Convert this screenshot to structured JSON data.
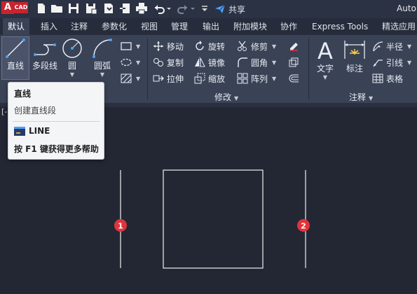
{
  "app": {
    "logo_letter": "A",
    "logo_text": "CAD",
    "share_label": "共享",
    "title": "Auto"
  },
  "quick_access": [
    "new-icon",
    "open-icon",
    "save-icon",
    "save-as-icon",
    "open-from-web-icon",
    "save-to-web-icon",
    "print-icon",
    "undo-icon",
    "redo-icon",
    "customize-icon"
  ],
  "tabs": [
    "默认",
    "插入",
    "注释",
    "参数化",
    "视图",
    "管理",
    "输出",
    "附加模块",
    "协作",
    "Express Tools",
    "精选应用"
  ],
  "ribbon": {
    "draw": {
      "line": "直线",
      "polyline": "多段线",
      "circle": "圆",
      "arc": "圆弧"
    },
    "modify": {
      "label": "修改",
      "move": "移动",
      "rotate": "旋转",
      "trim": "修剪",
      "copy": "复制",
      "mirror": "镜像",
      "fillet": "圆角",
      "stretch": "拉伸",
      "scale": "缩放",
      "array": "阵列"
    },
    "annotation": {
      "label": "注释",
      "text": "文字",
      "dimension": "标注",
      "radius": "半径",
      "leader": "引线",
      "table": "表格"
    }
  },
  "tooltip": {
    "title": "直线",
    "description": "创建直线段",
    "command": "LINE",
    "help_key": "F1",
    "help": "按 F1 键获得更多帮助"
  },
  "viewport": {
    "label": "[-",
    "markers": [
      "1",
      "2"
    ]
  },
  "colors": {
    "background": "#222733",
    "ribbon": "#3a4256",
    "accent_red": "#e0343c",
    "geometry": "#f0f0f0"
  }
}
